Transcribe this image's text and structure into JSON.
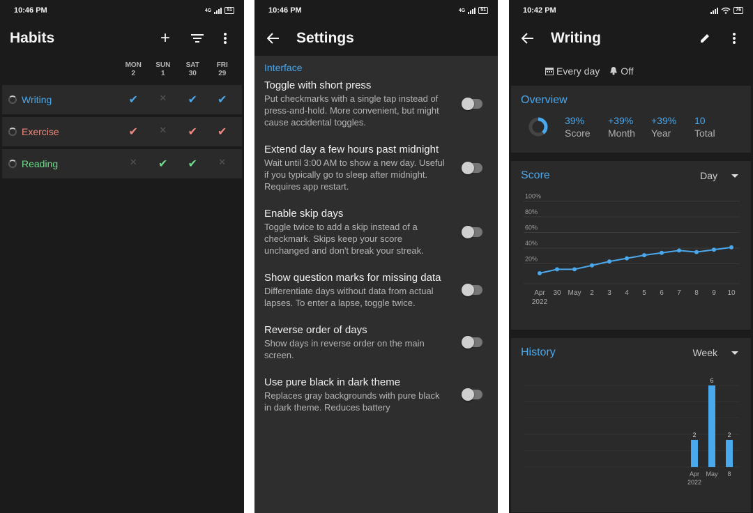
{
  "habits_screen": {
    "status_time": "10:46 PM",
    "battery": "51",
    "network": "4G",
    "title": "Habits",
    "days": [
      {
        "dow": "MON",
        "date": "2"
      },
      {
        "dow": "SUN",
        "date": "1"
      },
      {
        "dow": "SAT",
        "date": "30"
      },
      {
        "dow": "FRI",
        "date": "29"
      }
    ],
    "habits": [
      {
        "name": "Writing",
        "color": "#4aa8ec",
        "marks": [
          "check",
          "x",
          "check",
          "check"
        ]
      },
      {
        "name": "Exercise",
        "color": "#ef8a80",
        "marks": [
          "check",
          "x",
          "check",
          "check"
        ]
      },
      {
        "name": "Reading",
        "color": "#6fdc8c",
        "marks": [
          "x",
          "check",
          "check",
          "x"
        ]
      }
    ]
  },
  "settings_screen": {
    "status_time": "10:46 PM",
    "battery": "51",
    "network": "4G",
    "title": "Settings",
    "section": "Interface",
    "items": [
      {
        "title": "Toggle with short press",
        "desc": "Put checkmarks with a single tap instead of press-and-hold. More convenient, but might cause accidental toggles.",
        "enabled": false
      },
      {
        "title": "Extend day a few hours past midnight",
        "desc": "Wait until 3:00 AM to show a new day. Useful if you typically go to sleep after midnight. Requires app restart.",
        "enabled": false
      },
      {
        "title": "Enable skip days",
        "desc": "Toggle twice to add a skip instead of a checkmark. Skips keep your score unchanged and don't break your streak.",
        "enabled": false
      },
      {
        "title": "Show question marks for missing data",
        "desc": "Differentiate days without data from actual lapses. To enter a lapse, toggle twice.",
        "enabled": false
      },
      {
        "title": "Reverse order of days",
        "desc": "Show days in reverse order on the main screen.",
        "enabled": false
      },
      {
        "title": "Use pure black in dark theme",
        "desc": "Replaces gray backgrounds with pure black in dark theme. Reduces battery",
        "enabled": false
      }
    ]
  },
  "writing_screen": {
    "status_time": "10:42 PM",
    "battery": "76",
    "title": "Writing",
    "frequency": "Every day",
    "reminder": "Off",
    "overview": {
      "title": "Overview",
      "score_fraction": 0.39,
      "stats": [
        {
          "value": "39%",
          "label": "Score"
        },
        {
          "value": "+39%",
          "label": "Month"
        },
        {
          "value": "+39%",
          "label": "Year"
        },
        {
          "value": "10",
          "label": "Total"
        }
      ]
    },
    "score_card": {
      "title": "Score",
      "dropdown": "Day"
    },
    "history_card": {
      "title": "History",
      "dropdown": "Week"
    }
  },
  "chart_data": [
    {
      "type": "line",
      "title": "Score",
      "y_ticks": [
        "100%",
        "80%",
        "60%",
        "40%",
        "20%"
      ],
      "ylim": [
        0,
        100
      ],
      "x_labels": [
        [
          "Apr",
          "2022"
        ],
        [
          "30",
          ""
        ],
        [
          "May",
          ""
        ],
        [
          "2",
          ""
        ],
        [
          "3",
          ""
        ],
        [
          "4",
          ""
        ],
        [
          "5",
          ""
        ],
        [
          "6",
          ""
        ],
        [
          "7",
          ""
        ],
        [
          "8",
          ""
        ],
        [
          "9",
          ""
        ],
        [
          "10",
          ""
        ]
      ],
      "values": [
        8,
        13,
        13,
        18,
        23,
        27,
        31,
        34,
        37,
        35,
        38,
        41
      ]
    },
    {
      "type": "bar",
      "title": "History",
      "categories": [
        [
          "Apr",
          "2022"
        ],
        [
          "May",
          ""
        ],
        [
          "8",
          ""
        ]
      ],
      "values": [
        2,
        6,
        2
      ],
      "ylim": [
        0,
        6
      ]
    }
  ],
  "colors": {
    "accent": "#4aa8ec",
    "background": "#1b1b1b",
    "card": "#2a2a2a"
  }
}
